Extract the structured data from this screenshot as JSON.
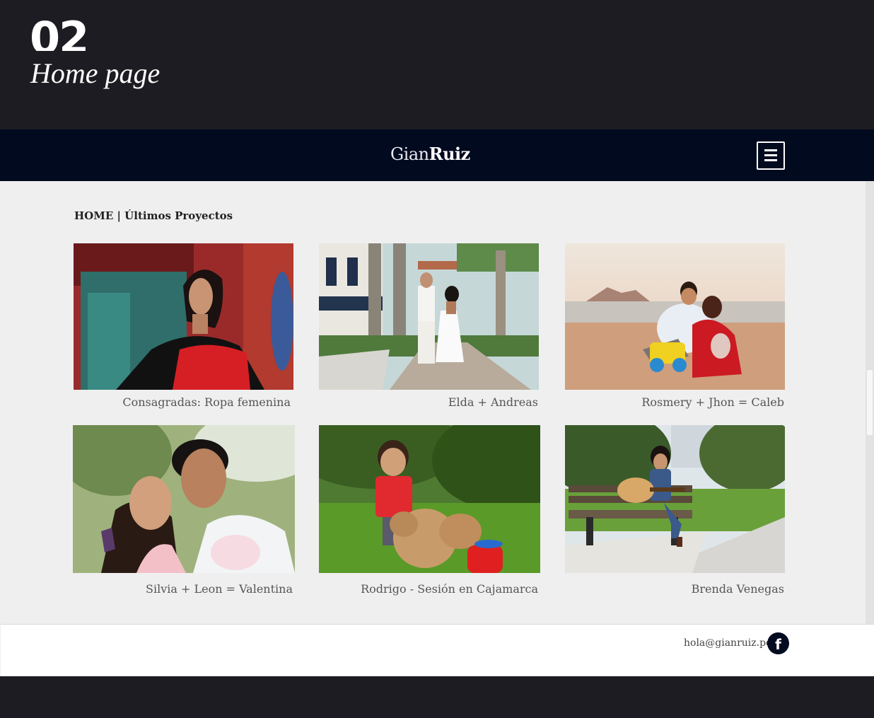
{
  "slide": {
    "number": "02",
    "title": "Home page"
  },
  "header": {
    "logo_light": "Gian",
    "logo_bold": "Ruiz",
    "menu_icon": "hamburger-menu-icon"
  },
  "breadcrumb": "HOME | Últimos Proyectos",
  "projects": [
    {
      "caption": "Consagradas: Ropa femenina"
    },
    {
      "caption": "Elda + Andreas"
    },
    {
      "caption": "Rosmery + Jhon = Caleb"
    },
    {
      "caption": "Silvia + Leon = Valentina"
    },
    {
      "caption": "Rodrigo - Sesión en Cajamarca"
    },
    {
      "caption": "Brenda Venegas"
    }
  ],
  "footer": {
    "email": "hola@gianruiz.pe",
    "social_icon": "facebook-icon",
    "social_glyph": "f"
  },
  "colors": {
    "navbar": "#020a20",
    "page": "#1c1c22",
    "content_bg": "#efefef"
  }
}
